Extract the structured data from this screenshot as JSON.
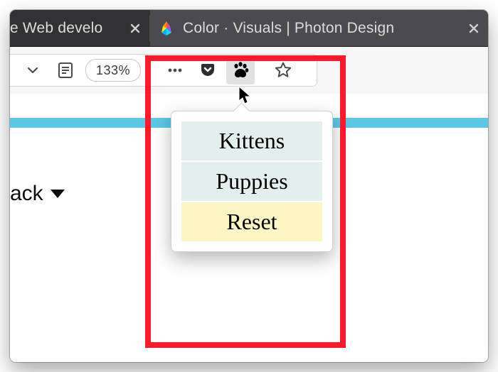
{
  "tabs": {
    "tab1": {
      "label": "e Web develo"
    },
    "tab2": {
      "label": "Color · Visuals | Photon Design"
    }
  },
  "toolbar": {
    "zoom_label": "133%"
  },
  "page": {
    "dropdown_label": "ack"
  },
  "popup": {
    "items": [
      {
        "label": "Kittens",
        "tone": "pale-teal"
      },
      {
        "label": "Puppies",
        "tone": "pale-teal"
      },
      {
        "label": "Reset",
        "tone": "pale-yellow"
      }
    ]
  }
}
